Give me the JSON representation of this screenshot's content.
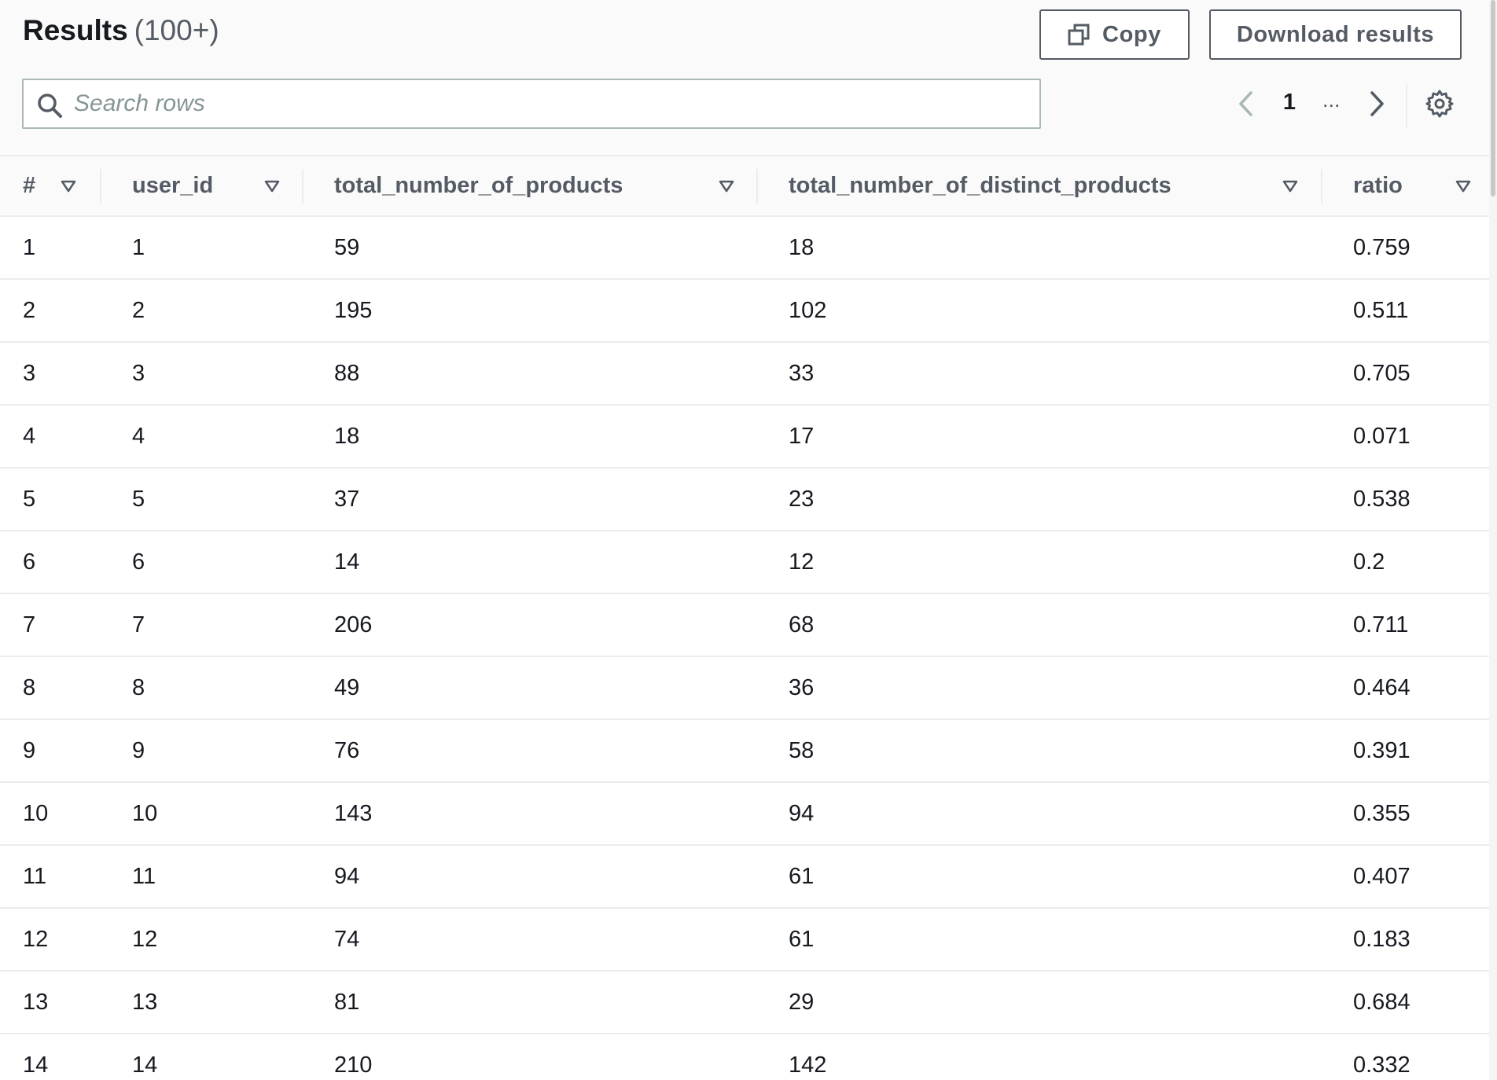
{
  "header": {
    "title": "Results",
    "count": "(100+)"
  },
  "toolbar": {
    "copy_label": "Copy",
    "download_label": "Download results"
  },
  "search": {
    "placeholder": "Search rows",
    "value": ""
  },
  "pagination": {
    "current_page": "1",
    "ellipsis": "..."
  },
  "table": {
    "columns": [
      "#",
      "user_id",
      "total_number_of_products",
      "total_number_of_distinct_products",
      "ratio"
    ],
    "rows": [
      [
        "1",
        "1",
        "59",
        "18",
        "0.759"
      ],
      [
        "2",
        "2",
        "195",
        "102",
        "0.511"
      ],
      [
        "3",
        "3",
        "88",
        "33",
        "0.705"
      ],
      [
        "4",
        "4",
        "18",
        "17",
        "0.071"
      ],
      [
        "5",
        "5",
        "37",
        "23",
        "0.538"
      ],
      [
        "6",
        "6",
        "14",
        "12",
        "0.2"
      ],
      [
        "7",
        "7",
        "206",
        "68",
        "0.711"
      ],
      [
        "8",
        "8",
        "49",
        "36",
        "0.464"
      ],
      [
        "9",
        "9",
        "76",
        "58",
        "0.391"
      ],
      [
        "10",
        "10",
        "143",
        "94",
        "0.355"
      ],
      [
        "11",
        "11",
        "94",
        "61",
        "0.407"
      ],
      [
        "12",
        "12",
        "74",
        "61",
        "0.183"
      ],
      [
        "13",
        "13",
        "81",
        "29",
        "0.684"
      ],
      [
        "14",
        "14",
        "210",
        "142",
        "0.332"
      ]
    ]
  },
  "colors": {
    "text_primary": "#16191f",
    "text_secondary": "#545b64",
    "border": "#eaeded",
    "header_bg": "#fafafa"
  }
}
